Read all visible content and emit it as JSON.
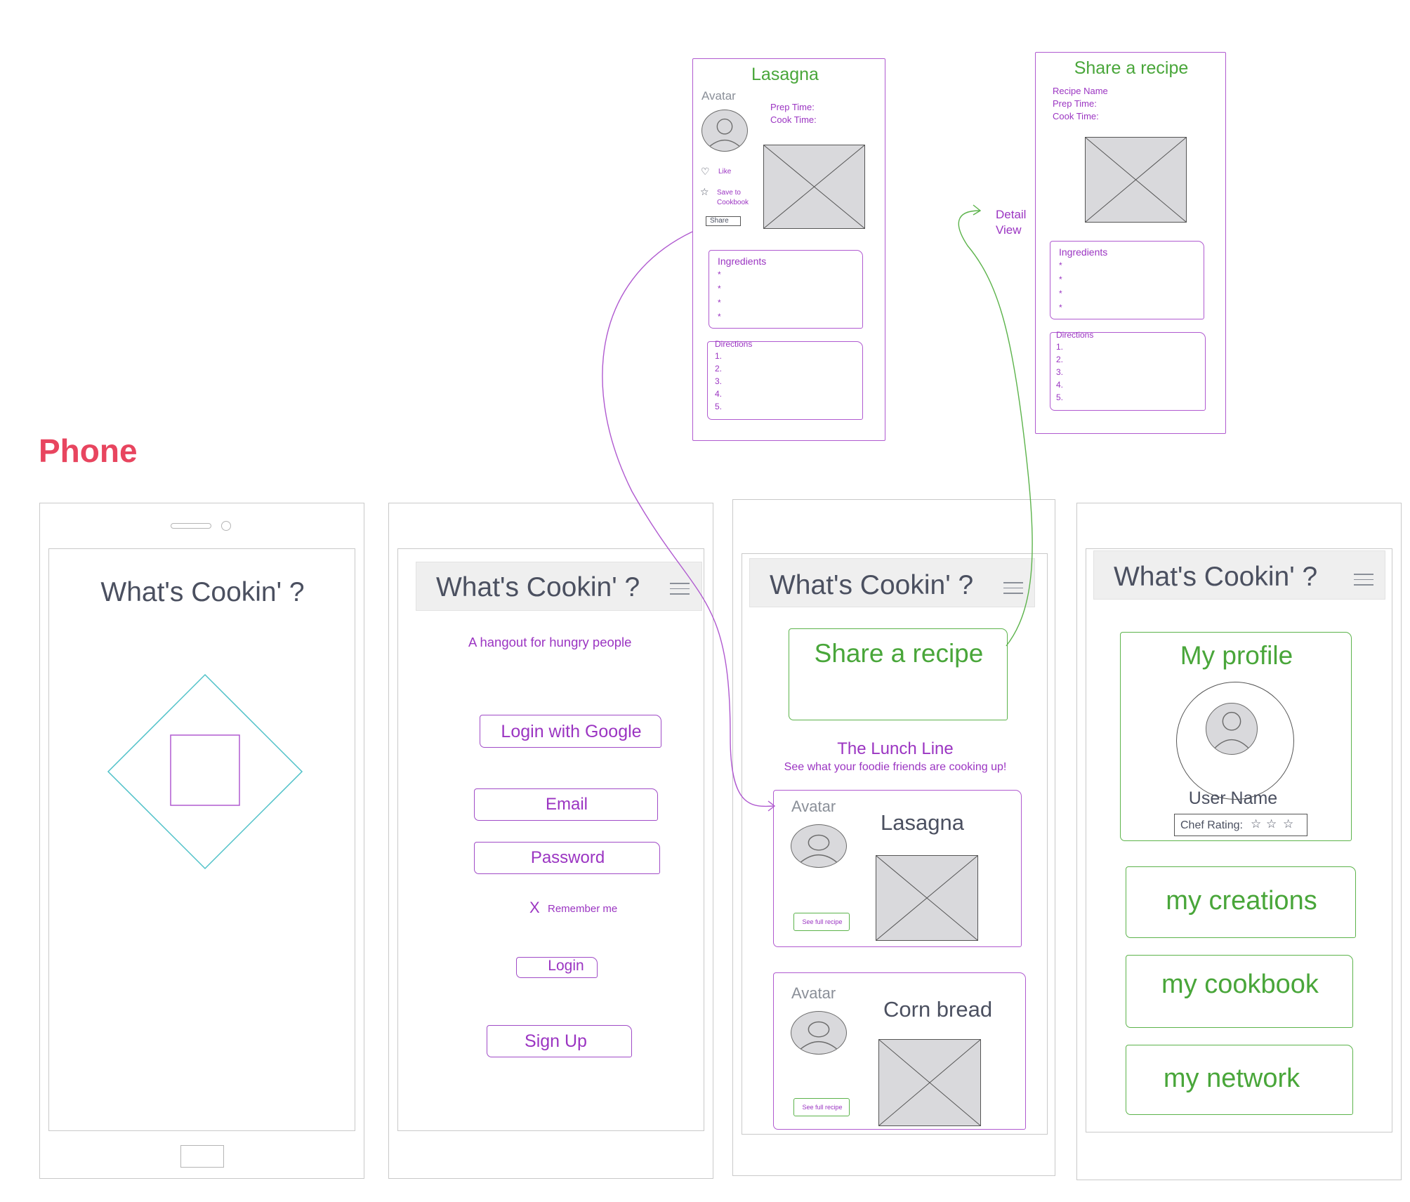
{
  "section_title": "Phone",
  "app_title": "What's Cookin' ?",
  "login": {
    "tagline": "A hangout for hungry people",
    "google_label": "Login with Google",
    "email_label": "Email",
    "password_label": "Password",
    "remember_mark": "X",
    "remember_label": "Remember me",
    "login_label": "Login",
    "signup_label": "Sign Up"
  },
  "feed": {
    "share_label": "Share a recipe",
    "lunch_title": "The Lunch Line",
    "lunch_subtitle": "See what your foodie friends are cooking up!",
    "cards": [
      {
        "avatar_label": "Avatar",
        "title": "Lasagna",
        "button": "See full recipe"
      },
      {
        "avatar_label": "Avatar",
        "title": "Corn bread",
        "button": "See full recipe"
      }
    ]
  },
  "profile": {
    "title": "My profile",
    "user_name": "User Name",
    "rating_label": "Chef Rating:",
    "rating_stars": 3,
    "buttons": [
      "my creations",
      "my cookbook",
      "my network"
    ]
  },
  "detail": {
    "title": "Lasagna",
    "avatar_label": "Avatar",
    "prep_label": "Prep Time:",
    "cook_label": "Cook Time:",
    "like_label": "Like",
    "save_label_1": "Save to",
    "save_label_2": "Cookbook",
    "share_label": "Share",
    "ingredients_label": "Ingredients",
    "ingredient_bullets": [
      "*",
      "*",
      "*",
      "*"
    ],
    "directions_label": "Directions",
    "direction_steps": [
      "1.",
      "2.",
      "3.",
      "4.",
      "5."
    ]
  },
  "share_form": {
    "title": "Share a recipe",
    "name_label": "Recipe Name",
    "prep_label": "Prep Time:",
    "cook_label": "Cook Time:",
    "ingredients_label": "Ingredients",
    "ingredient_bullets": [
      "*",
      "*",
      "*",
      "*"
    ],
    "directions_label": "Directions",
    "direction_steps": [
      "1.",
      "2.",
      "3.",
      "4.",
      "5."
    ]
  },
  "annotation": {
    "line1": "Detail",
    "line2": "View"
  },
  "colors": {
    "section_title": "#e8455f",
    "purple": "#9b35c2",
    "green": "#49a63a",
    "dark_text": "#4b5060",
    "splash_diamond": "#4fc1c8",
    "splash_square": "#b05ad0"
  }
}
